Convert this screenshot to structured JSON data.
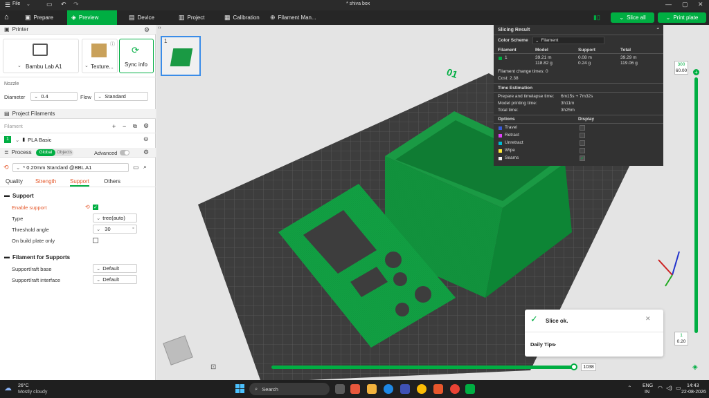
{
  "titlebar": {
    "file_label": "File",
    "title": "* shiva box"
  },
  "toolbar": {
    "tabs": [
      {
        "label": "Prepare"
      },
      {
        "label": "Preview"
      },
      {
        "label": "Device"
      },
      {
        "label": "Project"
      },
      {
        "label": "Calibration"
      },
      {
        "label": "Filament Man..."
      }
    ],
    "slice_all": "Slice all",
    "print_plate": "Print plate"
  },
  "printer": {
    "header": "Printer",
    "printer_name": "Bambu Lab A1",
    "plate_type": "Texture...",
    "sync_info": "Sync info",
    "nozzle_label": "Nozzle",
    "diameter_label": "Diameter",
    "diameter_value": "0.4",
    "flow_label": "Flow",
    "flow_value": "Standard"
  },
  "filaments": {
    "header": "Project Filaments",
    "list_label": "Filament",
    "items": [
      {
        "index": "1",
        "name": "PLA Basic",
        "color": "#00ae42"
      }
    ]
  },
  "process": {
    "header": "Process",
    "global": "Global",
    "objects": "Objects",
    "advanced": "Advanced",
    "profile": "* 0.20mm Standard @BBL A1",
    "tabs": [
      "Quality",
      "Strength",
      "Support",
      "Others"
    ],
    "support_section": "Support",
    "enable_support": "Enable support",
    "type_label": "Type",
    "type_value": "tree(auto)",
    "threshold_label": "Threshold angle",
    "threshold_value": "30",
    "threshold_unit": "°",
    "build_plate_only": "On build plate only",
    "fs_section": "Filament for Supports",
    "raft_base_label": "Support/raft base",
    "raft_base_value": "Default",
    "raft_interface_label": "Support/raft interface",
    "raft_interface_value": "Default"
  },
  "plate_thumb": {
    "index": "1"
  },
  "slicing": {
    "title": "Slicing Result",
    "color_scheme_label": "Color Scheme",
    "color_scheme_value": "Filament",
    "cols": [
      "Filament",
      "Model",
      "Support",
      "Total"
    ],
    "row": {
      "index": "1",
      "model_m": "39.21 m",
      "model_g": "118.82 g",
      "support_m": "0.08 m",
      "support_g": "0.24 g",
      "total_m": "39.29 m",
      "total_g": "119.06 g"
    },
    "change_times": "Filament change times:  0",
    "cost": "Cost:  2.38",
    "time_title": "Time Estimation",
    "prepare_label": "Prepare and timelapse time:",
    "prepare_value": "6m15s + 7m32s",
    "model_time_label": "Model printing time:",
    "model_time_value": "3h11m",
    "total_time_label": "Total time:",
    "total_time_value": "3h25m",
    "options_label": "Options",
    "display_label": "Display",
    "options": [
      {
        "name": "Travel",
        "color": "#3a5bd9"
      },
      {
        "name": "Retract",
        "color": "#e040fb"
      },
      {
        "name": "Unretract",
        "color": "#00bcd4"
      },
      {
        "name": "Wipe",
        "color": "#ffeb3b"
      },
      {
        "name": "Seams",
        "color": "#f0f0f0"
      }
    ]
  },
  "layer_slider": {
    "top_layer": "300",
    "top_height": "60.00",
    "bottom_layer": "1",
    "bottom_height": "0.20"
  },
  "move_slider": {
    "value": "1038"
  },
  "notification": {
    "status": "Slice ok.",
    "tips": "Daily Tips"
  },
  "plate_label": "01",
  "taskbar": {
    "temp": "26°C",
    "weather": "Mostly cloudy",
    "search": "Search",
    "lang": "ENG",
    "region": "IN",
    "time": "14:43",
    "date": "22-08-2026"
  }
}
